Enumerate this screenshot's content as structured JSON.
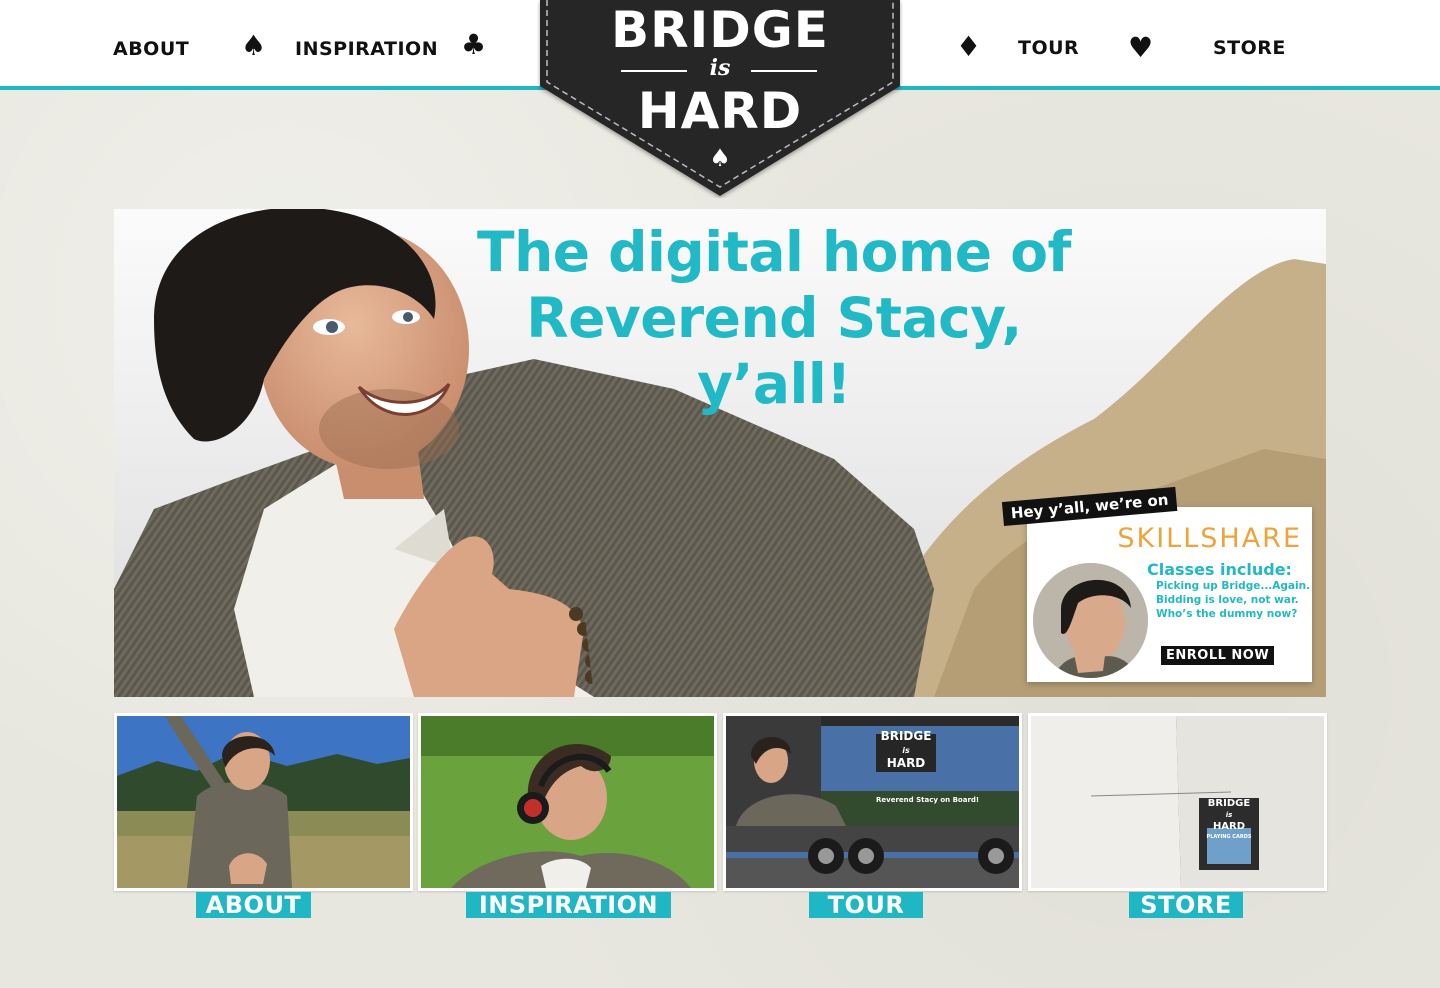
{
  "nav": {
    "left": [
      {
        "label": "ABOUT"
      },
      {
        "label": "INSPIRATION"
      }
    ],
    "right": [
      {
        "label": "TOUR"
      },
      {
        "label": "STORE"
      }
    ],
    "suits": {
      "spade": "♠",
      "club": "♣",
      "diamond": "♦",
      "heart": "♥"
    }
  },
  "logo": {
    "line1": "BRIDGE",
    "line2": "is",
    "line3": "HARD",
    "spade": "♠"
  },
  "hero": {
    "headline_1": "The digital home of",
    "headline_2": "Reverend Stacy, y’all!"
  },
  "ad": {
    "tag": "Hey y’all, we’re on",
    "brand": "SKILLSHARE",
    "classes_heading": "Classes include:",
    "courses": [
      "Picking up Bridge...Again.",
      "Bidding is love, not war.",
      "Who’s the dummy now?"
    ],
    "cta": "ENROLL NOW"
  },
  "tiles": [
    {
      "label": "ABOUT"
    },
    {
      "label": "INSPIRATION"
    },
    {
      "label": "TOUR",
      "bus_logo_1": "BRIDGE",
      "bus_logo_2": "is",
      "bus_logo_3": "HARD",
      "bus_caption": "Reverend Stacy on Board!"
    },
    {
      "label": "STORE",
      "box_logo_1": "BRIDGE",
      "box_logo_2": "is",
      "box_logo_3": "HARD",
      "box_caption": "PLAYING CARDS"
    }
  ],
  "colors": {
    "accent": "#1fb7c3",
    "badge": "#2a2a2a",
    "background": "#e8e7df"
  }
}
